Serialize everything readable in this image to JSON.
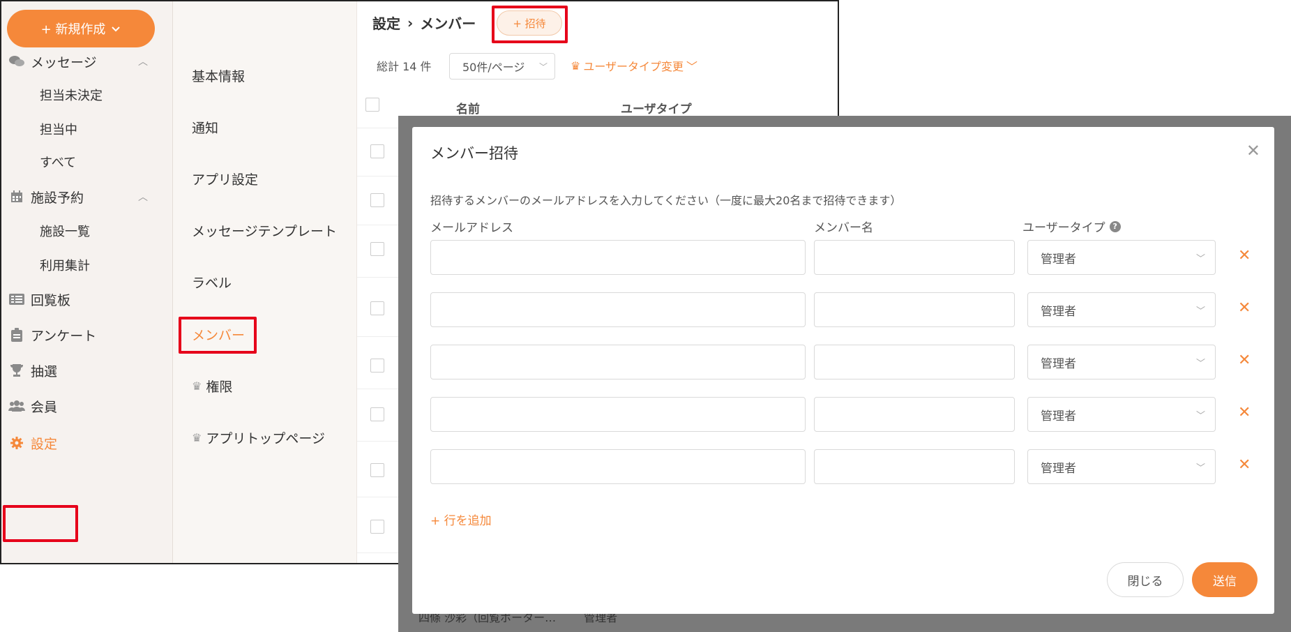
{
  "nav": {
    "new_button": "+ 新規作成",
    "messages": "メッセージ",
    "msg_sub": [
      "担当未決定",
      "担当中",
      "すべて"
    ],
    "facility": "施設予約",
    "facility_sub": [
      "施設一覧",
      "利用集計"
    ],
    "circular": "回覧板",
    "survey": "アンケート",
    "lottery": "抽選",
    "members": "会員",
    "settings": "設定"
  },
  "settings_menu": [
    "基本情報",
    "通知",
    "アプリ設定",
    "メッセージテンプレート",
    "ラベル",
    "メンバー",
    "権限",
    "アプリトップページ"
  ],
  "header": {
    "breadcrumb_root": "設定",
    "breadcrumb_sep": "›",
    "breadcrumb_current": "メンバー",
    "invite_button": "+ 招待"
  },
  "toolbar": {
    "total": "総計 14 件",
    "per_page": "50件/ページ",
    "usertype_change": "ユーザータイプ変更"
  },
  "table": {
    "col_name": "名前",
    "col_type": "ユーザタイプ",
    "bottom_row_name": "四條 沙彩（回覧ボーター…",
    "bottom_row_type": "管理者"
  },
  "modal": {
    "title": "メンバー招待",
    "description": "招待するメンバーのメールアドレスを入力してください（一度に最大20名まで招待できます）",
    "col_email": "メールアドレス",
    "col_member_name": "メンバー名",
    "col_user_type": "ユーザータイプ",
    "help_icon": "?",
    "rows": [
      {
        "email": "",
        "name": "",
        "user_type": "管理者"
      },
      {
        "email": "",
        "name": "",
        "user_type": "管理者"
      },
      {
        "email": "",
        "name": "",
        "user_type": "管理者"
      },
      {
        "email": "",
        "name": "",
        "user_type": "管理者"
      },
      {
        "email": "",
        "name": "",
        "user_type": "管理者"
      }
    ],
    "add_row": "+ 行を追加",
    "close_button": "閉じる",
    "send_button": "送信"
  },
  "colors": {
    "accent": "#f5883a",
    "highlight": "#e6001a",
    "overlay": "#7a7a7a"
  },
  "icons": [
    "chevron-down-icon",
    "chat-icon",
    "calendar-icon",
    "list-icon",
    "clipboard-icon",
    "trophy-icon",
    "people-icon",
    "gear-icon",
    "crown-icon",
    "close-icon",
    "help-icon"
  ]
}
